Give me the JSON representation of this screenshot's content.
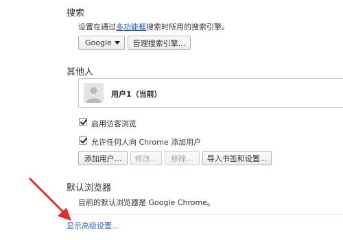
{
  "search": {
    "title": "搜索",
    "desc_prefix": "设置在通过",
    "desc_link": "多功能框",
    "desc_suffix": "搜索时所用的搜索引擎。",
    "engine_selected": "Google",
    "manage_button": "管理搜索引擎..."
  },
  "people": {
    "title": "其他人",
    "user_label": "用户1（当前）",
    "guest_checkbox_label": "启用访客浏览",
    "guest_checked": true,
    "allow_add_checkbox_label": "允许任何人向 Chrome 添加用户",
    "allow_add_checked": true,
    "add_user_button": "添加用户...",
    "edit_button": "修改...",
    "remove_button": "移除...",
    "import_button": "导入书签和设置..."
  },
  "default_browser": {
    "title": "默认浏览器",
    "status": "目前的默认浏览器是 Google Chrome。"
  },
  "advanced_link": "显示高级设置...",
  "annotation": {
    "arrow_color": "#e8262d"
  },
  "icons": {
    "dropdown": "chevron-down-icon",
    "checkbox": "checkmark-icon",
    "avatar": "user-avatar-icon",
    "arrow": "red-arrow-icon"
  }
}
